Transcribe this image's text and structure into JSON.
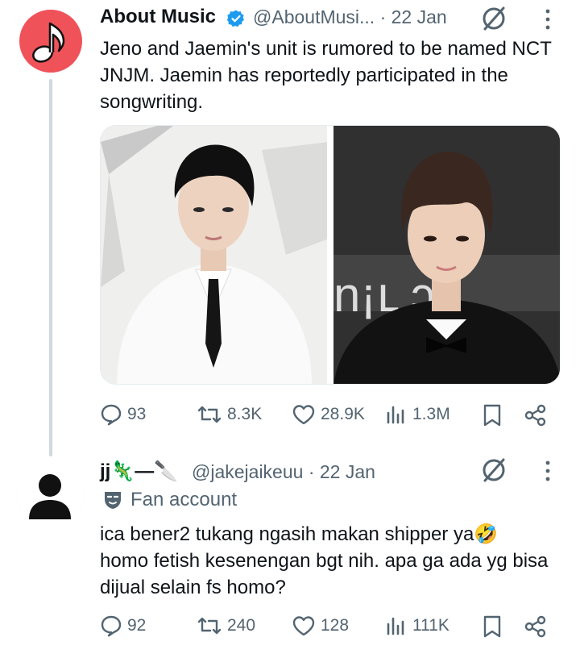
{
  "tweet1": {
    "display_name": "About Music",
    "handle_date": "@AboutMusi... · 22 Jan",
    "text": "Jeno and Jaemin's unit is rumored to be named NCT JNJM. Jaemin has reportedly participated in the songwriting.",
    "actions": {
      "replies": "93",
      "retweets": "8.3K",
      "likes": "28.9K",
      "views": "1.3M"
    }
  },
  "tweet2": {
    "display_name": "jj🦎—🔪",
    "handle_date": "@jakejaikeuu · 22 Jan",
    "badge": "Fan account",
    "text": "ica bener2 tukang ngasih makan shipper ya🤣 homo fetish kesenengan bgt nih. apa ga ada yg bisa dijual selain fs homo?",
    "actions": {
      "replies": "92",
      "retweets": "240",
      "likes": "128",
      "views": "111K"
    }
  },
  "colors": {
    "muted": "#536471",
    "text": "#0f1419",
    "brand_avatar": "#f0525a",
    "verified": "#1d9bf0"
  }
}
